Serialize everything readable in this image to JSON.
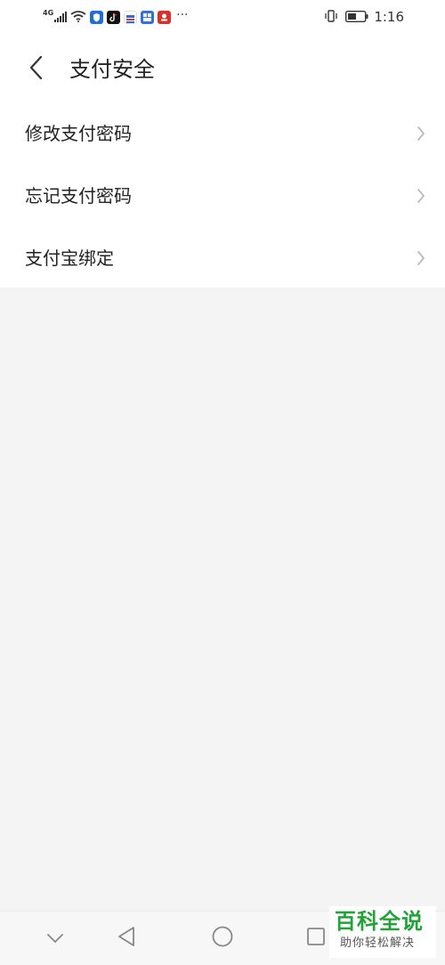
{
  "status_bar": {
    "network": "4G",
    "time": "1:16",
    "more": "···",
    "apps": [
      "shield-app-icon",
      "tiktok-app-icon",
      "bank-app-icon",
      "tieba-app-icon",
      "news-app-icon"
    ]
  },
  "header": {
    "title": "支付安全"
  },
  "list": {
    "items": [
      {
        "label": "修改支付密码"
      },
      {
        "label": "忘记支付密码"
      },
      {
        "label": "支付宝绑定"
      }
    ]
  },
  "watermark": {
    "title": "百科全说",
    "subtitle": "助你轻松解决"
  },
  "colors": {
    "background": "#f4f4f4",
    "surface": "#ffffff",
    "text": "#222222",
    "chevron": "#bbbbbb",
    "watermark_green": "#22a33a"
  }
}
